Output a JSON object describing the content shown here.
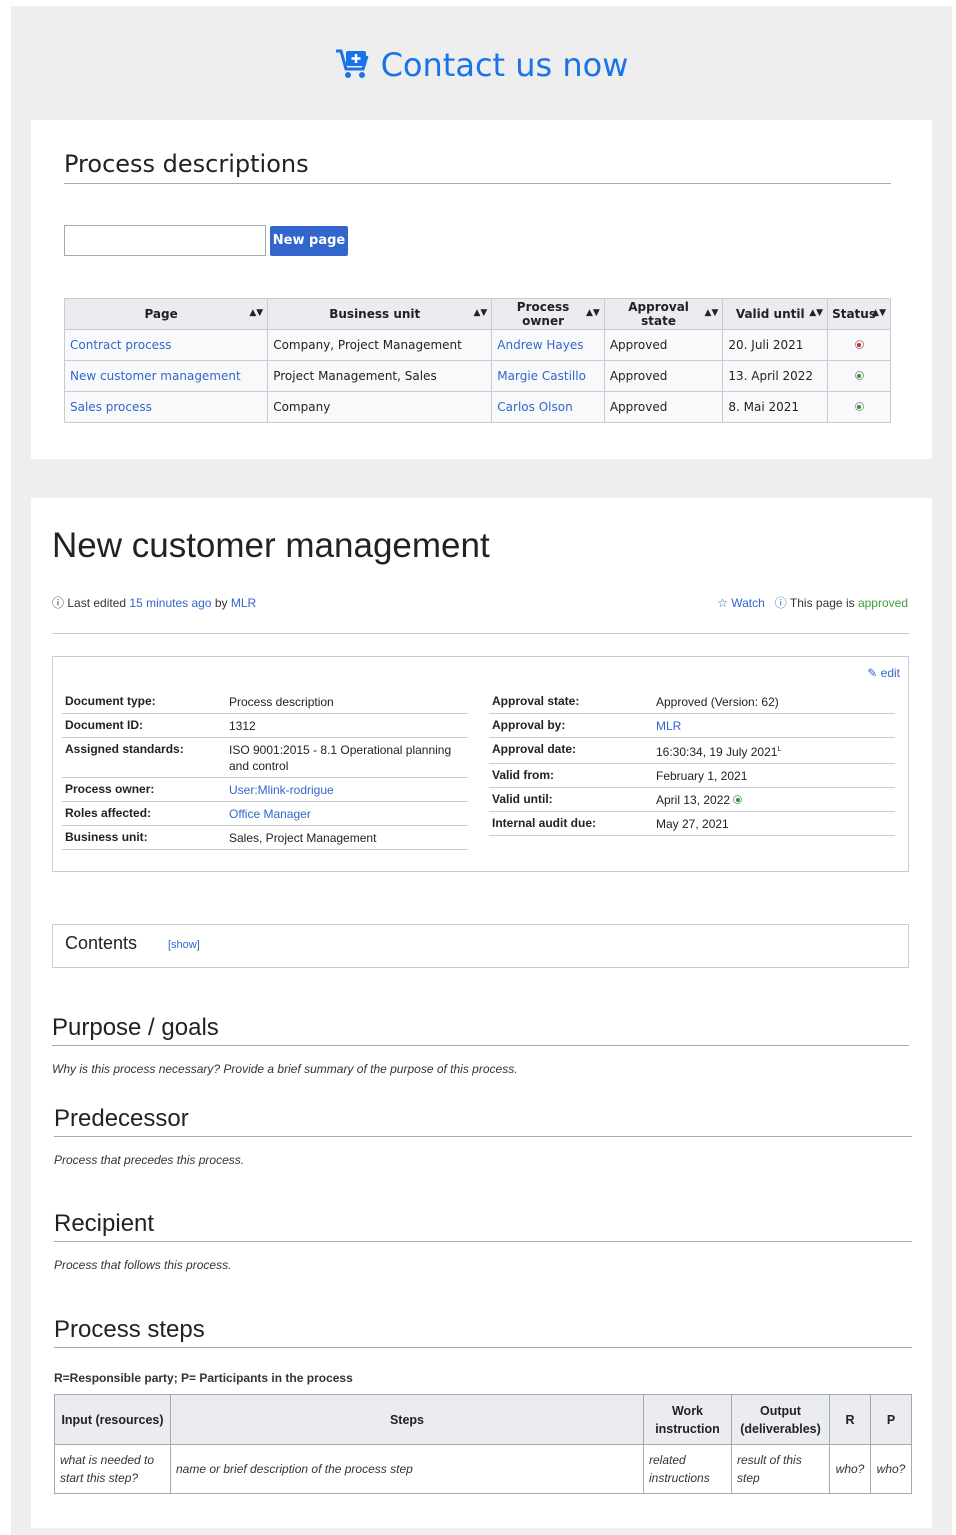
{
  "banner": {
    "contact_label": "Contact us now"
  },
  "process_list": {
    "heading": "Process descriptions",
    "search_value": "",
    "new_page_label": "New page",
    "columns": [
      "Page",
      "Business unit",
      "Process owner",
      "Approval state",
      "Valid until",
      "Status"
    ],
    "rows": [
      {
        "page": "Contract process",
        "unit": "Company, Project Management",
        "owner": "Andrew Hayes",
        "state": "Approved",
        "valid": "20. Juli 2021",
        "status": "red"
      },
      {
        "page": "New customer management",
        "unit": "Project Management, Sales",
        "owner": "Margie Castillo",
        "state": "Approved",
        "valid": "13. April 2022",
        "status": "green"
      },
      {
        "page": "Sales process",
        "unit": "Company",
        "owner": "Carlos Olson",
        "state": "Approved",
        "valid": "8. Mai 2021",
        "status": "green"
      }
    ]
  },
  "article": {
    "title": "New customer management",
    "last_edited_prefix": "Last edited",
    "last_edited_time": "15 minutes ago",
    "by": "by",
    "editor": "MLR",
    "watch_label": "Watch",
    "page_is": "This page is",
    "approved_word": "approved",
    "edit_label": "edit",
    "info_left": [
      {
        "k": "Document type:",
        "v": "Process description"
      },
      {
        "k": "Document ID:",
        "v": "1312"
      },
      {
        "k": "Assigned standards:",
        "v": "ISO 9001:2015 - 8.1 Operational planning and control"
      },
      {
        "k": "Process owner:",
        "v": "User:Mlink-rodrigue"
      },
      {
        "k": "Roles affected:",
        "v": "Office Manager"
      },
      {
        "k": "Business unit:",
        "v": "Sales, Project Management"
      }
    ],
    "info_right": [
      {
        "k": "Approval state:",
        "v": "Approved (Version: 62)"
      },
      {
        "k": "Approval by:",
        "v": "MLR"
      },
      {
        "k": "Approval date:",
        "v": "16:30:34, 19 July 2021"
      },
      {
        "k": "Valid from:",
        "v": "February 1, 2021"
      },
      {
        "k": "Valid until:",
        "v": "April 13, 2022"
      },
      {
        "k": "Internal audit due:",
        "v": "May 27, 2021"
      }
    ],
    "contents_label": "Contents",
    "contents_toggle": "[show]",
    "sections": [
      {
        "title": "Purpose / goals",
        "text": "Why is this process necessary? Provide a brief summary of the purpose of this process."
      },
      {
        "title": "Predecessor",
        "text": "Process that precedes this process."
      },
      {
        "title": "Recipient",
        "text": "Process that follows this process."
      },
      {
        "title": "Process steps",
        "text": ""
      }
    ],
    "steps_legend": "R=Responsible party; P= Participants in the process",
    "steps_columns": [
      "Input (resources)",
      "Steps",
      "Work instruction",
      "Output (deliverables)",
      "R",
      "P"
    ],
    "steps_row": [
      "what is needed to start this step?",
      "name or brief description of the process step",
      "related instructions",
      "result of this step",
      "who?",
      "who?"
    ]
  },
  "colors": {
    "accent": "#3366cc",
    "banner": "#1a73e8",
    "status_red": "#e02020",
    "status_green": "#2a9a2a",
    "approved": "#3aa33a"
  }
}
